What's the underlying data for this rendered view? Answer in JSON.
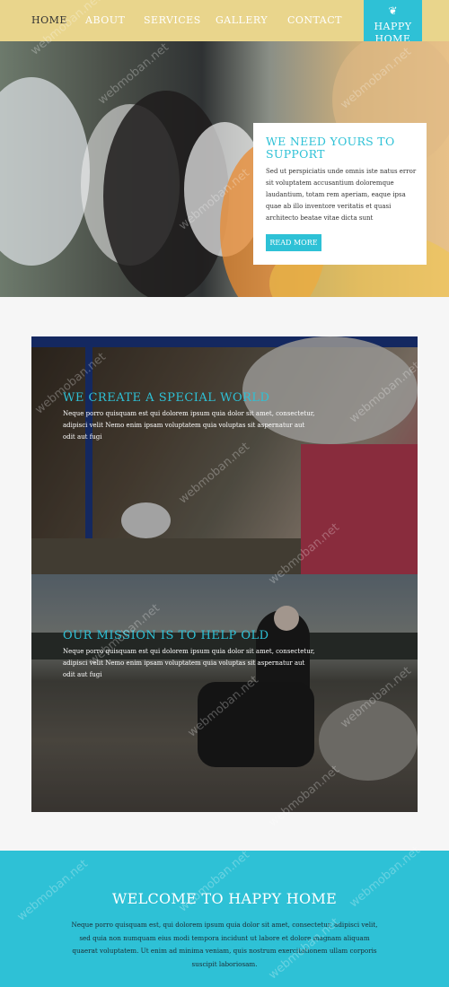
{
  "nav": {
    "items": [
      "HOME",
      "ABOUT",
      "SERVICES",
      "GALLERY",
      "CONTACT"
    ],
    "active": "HOME",
    "logo_line1": "HAPPY",
    "logo_line2": "HOME",
    "logo_ornament": "❦"
  },
  "hero": {
    "title": "WE NEED YOURS TO SUPPORT",
    "text": "Sed ut perspiciatis unde omnis iste natus error sit voluptatem accusantium doloremque laudantium, totam rem aperiam, eaque ipsa quae ab illo inventore veritatis et quasi architecto beatae vitae dicta sunt",
    "button": "READ MORE"
  },
  "features": [
    {
      "title": "WE CREATE A SPECIAL WORLD",
      "text": "Neque porro quisquam est qui dolorem ipsum quia dolor sit amet, consectetur, adipisci velit Nemo enim ipsam voluptatem quia voluptas sit aspernatur aut odit aut fugi"
    },
    {
      "title": "OUR MISSION IS TO HELP OLD",
      "text": "Neque porro quisquam est qui dolorem ipsum quia dolor sit amet, consectetur, adipisci velit Nemo enim ipsam voluptatem quia voluptas sit aspernatur aut odit aut fugi"
    }
  ],
  "welcome": {
    "title": "WELCOME TO HAPPY HOME",
    "text": "Neque porro quisquam est, qui dolorem ipsum quia dolor sit amet, consectetur, adipisci velit, sed quia non numquam eius modi tempora incidunt ut labore et dolore magnam aliquam quaerat voluptatem. Ut enim ad minima veniam, quis nostrum exercitationem ullam corporis suscipit laboriosam."
  },
  "watermark": "webmoban.net",
  "colors": {
    "accent": "#2ec1d6",
    "nav_bg": "#e9d58c",
    "page_bg": "#f6f6f6"
  }
}
